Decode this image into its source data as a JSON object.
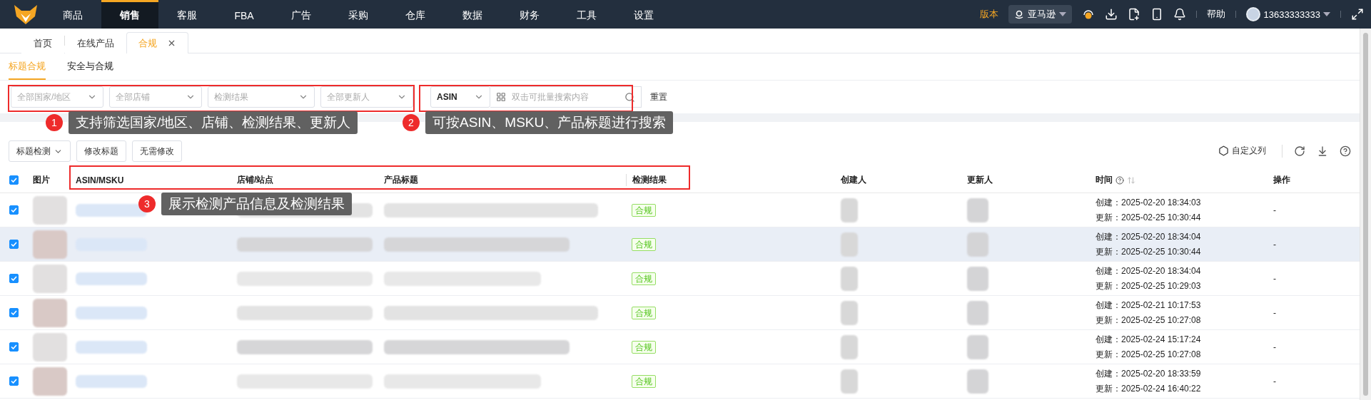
{
  "nav": {
    "items": [
      {
        "label": "商品",
        "selected": false
      },
      {
        "label": "销售",
        "selected": true
      },
      {
        "label": "客服",
        "selected": false
      },
      {
        "label": "FBA",
        "selected": false
      },
      {
        "label": "广告",
        "selected": false
      },
      {
        "label": "采购",
        "selected": false
      },
      {
        "label": "仓库",
        "selected": false
      },
      {
        "label": "数据",
        "selected": false
      },
      {
        "label": "财务",
        "selected": false
      },
      {
        "label": "工具",
        "selected": false
      },
      {
        "label": "设置",
        "selected": false
      }
    ],
    "version": "版本",
    "platform": "亚马逊",
    "help": "帮助",
    "user": "13633333333"
  },
  "page_tabs": [
    {
      "label": "首页",
      "selected": false,
      "closable": false
    },
    {
      "label": "在线产品",
      "selected": false,
      "closable": false
    },
    {
      "label": "合规",
      "selected": true,
      "closable": true
    }
  ],
  "sub_tabs": [
    {
      "label": "标题合规",
      "selected": true
    },
    {
      "label": "安全与合规",
      "selected": false
    }
  ],
  "filters": [
    {
      "placeholder": "全部国家/地区"
    },
    {
      "placeholder": "全部店铺"
    },
    {
      "placeholder": "检测结果"
    },
    {
      "placeholder": "全部更新人"
    }
  ],
  "search": {
    "field": "ASIN",
    "placeholder": "双击可批量搜索内容"
  },
  "reset": "重置",
  "actions": [
    {
      "label": "标题检测",
      "dropdown": true
    },
    {
      "label": "修改标题",
      "dropdown": false
    },
    {
      "label": "无需修改",
      "dropdown": false
    }
  ],
  "custom_columns": "自定义列",
  "table": {
    "all_checked": true,
    "columns": [
      {
        "label": "图片",
        "kind": "plain"
      },
      {
        "label": "ASIN/MSKU",
        "kind": "plain"
      },
      {
        "label": "店铺/站点",
        "kind": "plain"
      },
      {
        "label": "产品标题",
        "kind": "plain"
      },
      {
        "label": "检测结果",
        "kind": "divided"
      },
      {
        "label": "创建人",
        "kind": "plain"
      },
      {
        "label": "更新人",
        "kind": "plain"
      },
      {
        "label": "时间",
        "kind": "sortable"
      },
      {
        "label": "操作",
        "kind": "plain"
      }
    ],
    "rows": [
      {
        "checked": true,
        "selected": false,
        "result": "合规",
        "created": "创建：2025-02-20 18:34:03",
        "updated": "更新：2025-02-25 10:30:44",
        "action": "-"
      },
      {
        "checked": true,
        "selected": true,
        "result": "合规",
        "created": "创建：2025-02-20 18:34:04",
        "updated": "更新：2025-02-25 10:30:44",
        "action": "-"
      },
      {
        "checked": true,
        "selected": false,
        "result": "合规",
        "created": "创建：2025-02-20 18:34:04",
        "updated": "更新：2025-02-25 10:29:03",
        "action": "-"
      },
      {
        "checked": true,
        "selected": false,
        "result": "合规",
        "created": "创建：2025-02-21 10:17:53",
        "updated": "更新：2025-02-25 10:27:08",
        "action": "-"
      },
      {
        "checked": true,
        "selected": false,
        "result": "合规",
        "created": "创建：2025-02-24 15:17:24",
        "updated": "更新：2025-02-25 10:27:08",
        "action": "-"
      },
      {
        "checked": true,
        "selected": false,
        "result": "合规",
        "created": "创建：2025-02-20 18:33:59",
        "updated": "更新：2025-02-24 16:40:22",
        "action": "-"
      }
    ]
  },
  "annotations": [
    {
      "number": "1",
      "text": "支持筛选国家/地区、店铺、检测结果、更新人"
    },
    {
      "number": "2",
      "text": "可按ASIN、MSKU、产品标题进行搜索"
    },
    {
      "number": "3",
      "text": "展示检测产品信息及检测结果"
    }
  ]
}
